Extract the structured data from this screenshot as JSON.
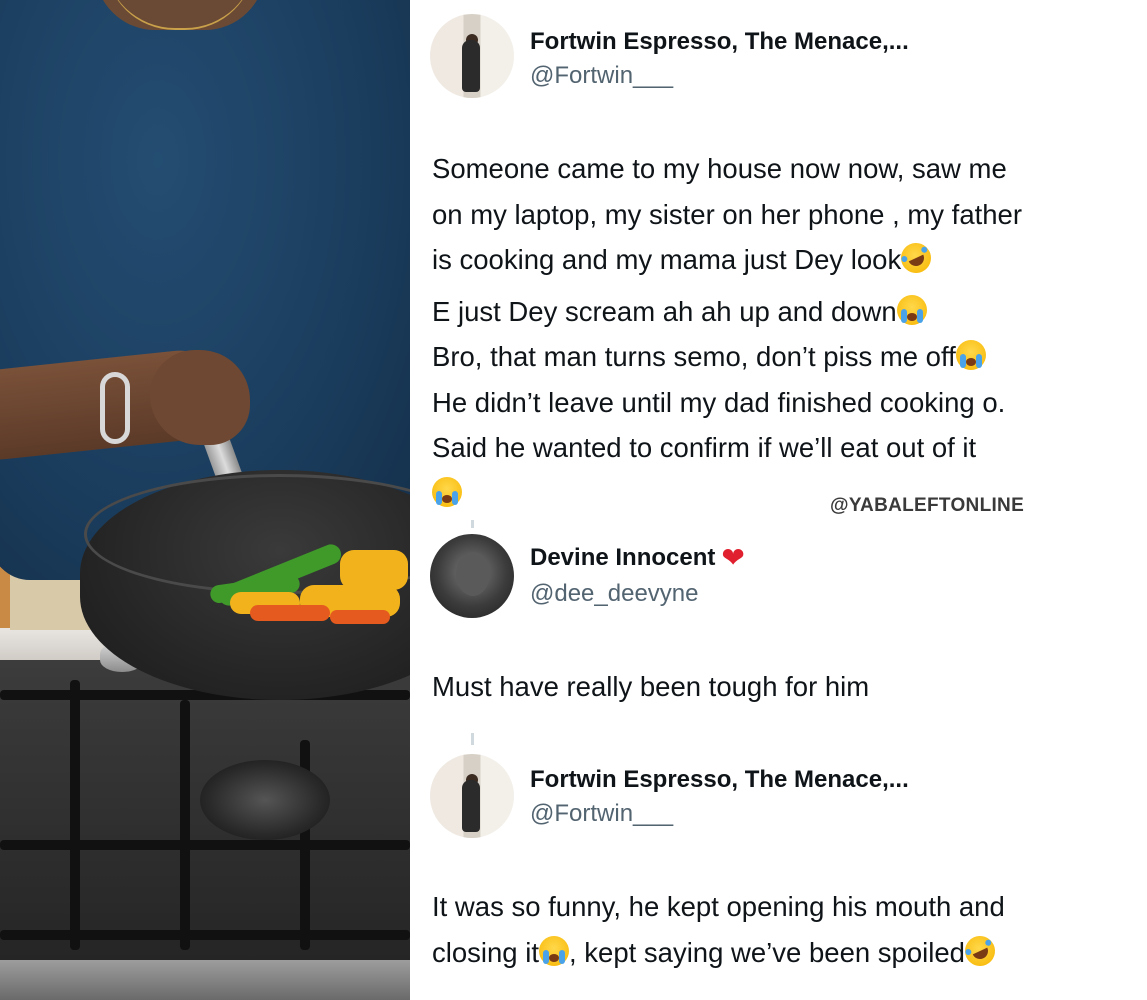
{
  "thread": {
    "tweets": [
      {
        "author_name": "Fortwin Espresso, The Menace,...",
        "author_handle": "@Fortwin___",
        "avatar": "fortwin-avatar",
        "lines": [
          "Someone came to my house now now, saw me",
          "on my laptop, my sister on her phone , my father",
          "is cooking and my mama just Dey look",
          "E just Dey scream ah ah up and down",
          "Bro, that man turns semo, don’t piss me off",
          "He didn’t leave until my dad finished cooking o.",
          "Said he wanted to confirm if we’ll eat out of it"
        ]
      },
      {
        "author_name": "Devine Innocent",
        "author_handle": "@dee_deevyne",
        "avatar": "devine-avatar",
        "name_emoji": "heart",
        "lines": [
          "Must have really been tough for him"
        ]
      },
      {
        "author_name": "Fortwin Espresso, The Menace,...",
        "author_handle": "@Fortwin___",
        "avatar": "fortwin-avatar",
        "lines": [
          "It was so funny, he kept opening his mouth and",
          "closing it",
          ", kept saying we’ve been spoiled"
        ]
      }
    ],
    "watermark": "@YABALEFTONLINE",
    "emoji_names": [
      "rolling-on-floor-laughing-emoji",
      "loudly-crying-emoji",
      "red-heart-emoji"
    ]
  },
  "colors": {
    "name": "#0f1419",
    "handle": "#536471",
    "heart": "#e0202e",
    "shirt": "#1b3e5f"
  }
}
